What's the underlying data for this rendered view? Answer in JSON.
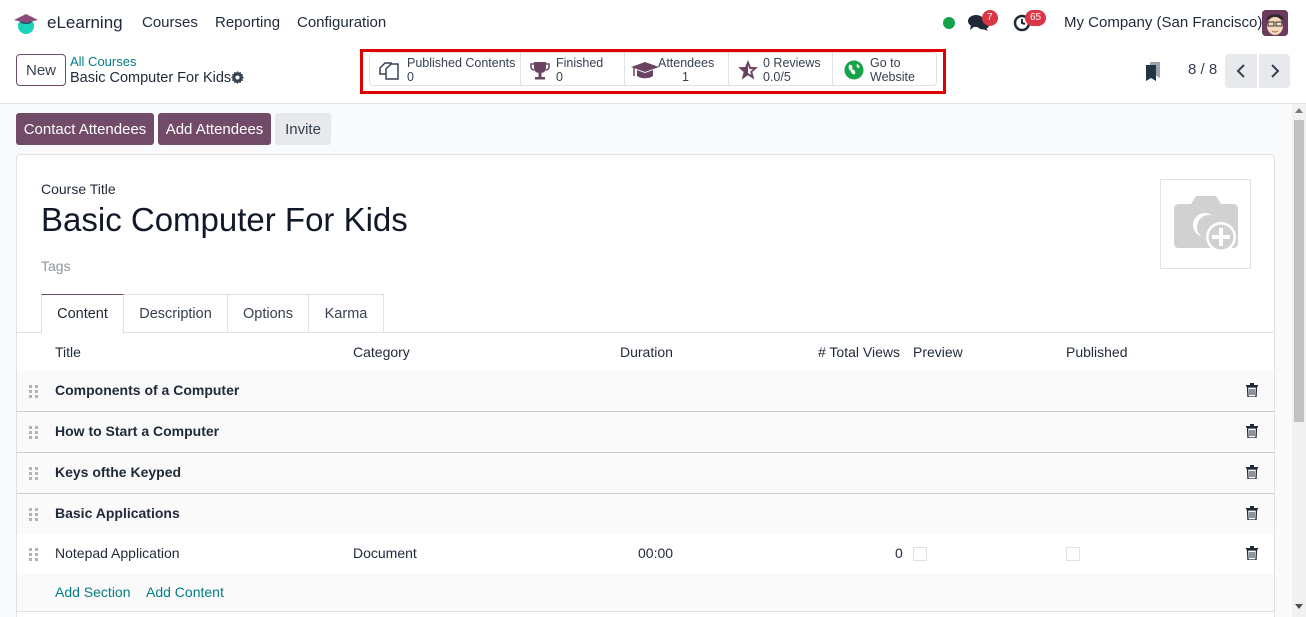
{
  "navbar": {
    "app_name": "eLearning",
    "menu": [
      {
        "label": "Courses"
      },
      {
        "label": "Reporting"
      },
      {
        "label": "Configuration"
      }
    ],
    "status": "online",
    "messages_count": "7",
    "activities_count": "65",
    "company": "My Company (San Francisco)",
    "icons": {
      "logo": "graduation-cap-logo",
      "messages": "chat-bubbles-icon",
      "activities": "clock-icon",
      "avatar": "user-avatar"
    }
  },
  "control_panel": {
    "new_label": "New",
    "breadcrumb_parent": "All Courses",
    "breadcrumb_current": "Basic Computer For Kids",
    "stats": [
      {
        "label": "Published Contents",
        "value": "0",
        "icon": "documents-icon"
      },
      {
        "label": "Finished",
        "value": "0",
        "icon": "trophy-icon"
      },
      {
        "label": "Attendees",
        "value": "1",
        "icon": "graduation-cap-icon"
      },
      {
        "label": "0 Reviews",
        "value": "0.0/5",
        "icon": "star-icon"
      },
      {
        "label": "Go to",
        "value": "Website",
        "icon": "globe-icon"
      }
    ],
    "pager": "8 / 8"
  },
  "actions": {
    "contact_attendees": "Contact Attendees",
    "add_attendees": "Add Attendees",
    "invite": "Invite"
  },
  "form": {
    "course_title_label": "Course Title",
    "course_title": "Basic Computer For Kids",
    "tags_placeholder": "Tags",
    "tabs": [
      {
        "label": "Content",
        "active": true
      },
      {
        "label": "Description",
        "active": false
      },
      {
        "label": "Options",
        "active": false
      },
      {
        "label": "Karma",
        "active": false
      }
    ],
    "table": {
      "columns": [
        "Title",
        "Category",
        "Duration",
        "# Total Views",
        "Preview",
        "Published"
      ],
      "rows": [
        {
          "type": "section",
          "title": "Components of a Computer"
        },
        {
          "type": "section",
          "title": "How to Start a Computer"
        },
        {
          "type": "section",
          "title": "Keys ofthe Keyped"
        },
        {
          "type": "section",
          "title": "Basic Applications"
        },
        {
          "type": "line",
          "title": "Notepad Application",
          "category": "Document",
          "duration": "00:00",
          "total_views": "0",
          "preview": false,
          "published": false
        }
      ],
      "add_section": "Add Section",
      "add_content": "Add Content"
    }
  },
  "colors": {
    "brand": "#714b67",
    "link": "#017e84",
    "highlight": "#e00000",
    "badge": "#dc3545",
    "online": "#15a04a"
  }
}
